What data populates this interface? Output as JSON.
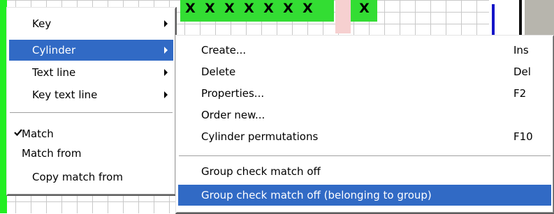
{
  "matrix": {
    "x_marks": [
      "X",
      "X",
      "X",
      "X",
      "X",
      "X",
      "X",
      "X"
    ],
    "colors": {
      "cell_green": "#33dd33",
      "cell_pink": "#f6d0d0",
      "bar_blue": "#1515c8"
    }
  },
  "context_menu": {
    "items": [
      {
        "label": "Key",
        "has_submenu": true
      },
      {
        "label": "Cylinder",
        "has_submenu": true,
        "highlighted": true
      },
      {
        "label": "Text line",
        "has_submenu": true
      },
      {
        "label": "Key text line",
        "has_submenu": true
      },
      {
        "label": "Match",
        "checked": true
      },
      {
        "label": "Match from"
      },
      {
        "label": "Copy match from"
      }
    ]
  },
  "cylinder_submenu": {
    "items": [
      {
        "label": "Create...",
        "shortcut": "Ins"
      },
      {
        "label": "Delete",
        "shortcut": "Del"
      },
      {
        "label": "Properties...",
        "shortcut": "F2"
      },
      {
        "label": "Order new...",
        "shortcut": ""
      },
      {
        "label": "Cylinder permutations",
        "shortcut": "F10"
      },
      {
        "label": "Group check match off",
        "shortcut": ""
      },
      {
        "label": "Group check match off (belonging to group)",
        "shortcut": "",
        "highlighted": true
      }
    ]
  },
  "colors": {
    "highlight": "#316ac5",
    "highlight_text": "#ffffff"
  },
  "icons": {
    "check": "check-icon",
    "submenu_arrow": "chevron-right-icon"
  }
}
